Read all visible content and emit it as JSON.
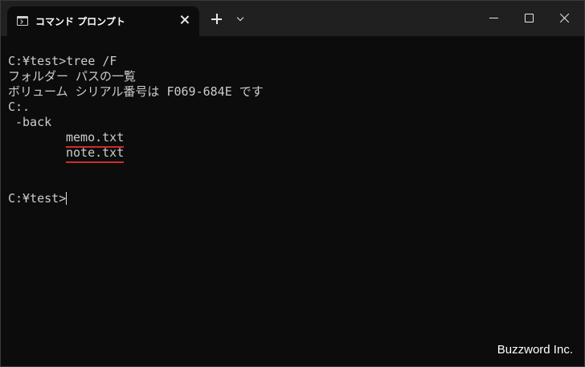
{
  "tab": {
    "title": "コマンド プロンプト"
  },
  "terminal": {
    "command_line": "C:¥test>tree /F",
    "listing_header": "フォルダー パスの一覧",
    "volume_line": "ボリューム シリアル番号は F069-684E です",
    "root": "C:.",
    "folder": "-back",
    "files": [
      "memo.txt",
      "note.txt"
    ],
    "prompt": "C:¥test>"
  },
  "icons": {
    "tab_icon": "terminal-icon",
    "tab_close": "close-icon",
    "new_tab": "plus-icon",
    "dropdown": "chevron-down-icon",
    "minimize": "minimize-icon",
    "maximize": "maximize-icon",
    "close": "close-icon"
  },
  "colors": {
    "background": "#0c0c0c",
    "titlebar": "#202020",
    "text": "#cccccc",
    "underline": "#d12a2a"
  },
  "watermark": "Buzzword Inc."
}
